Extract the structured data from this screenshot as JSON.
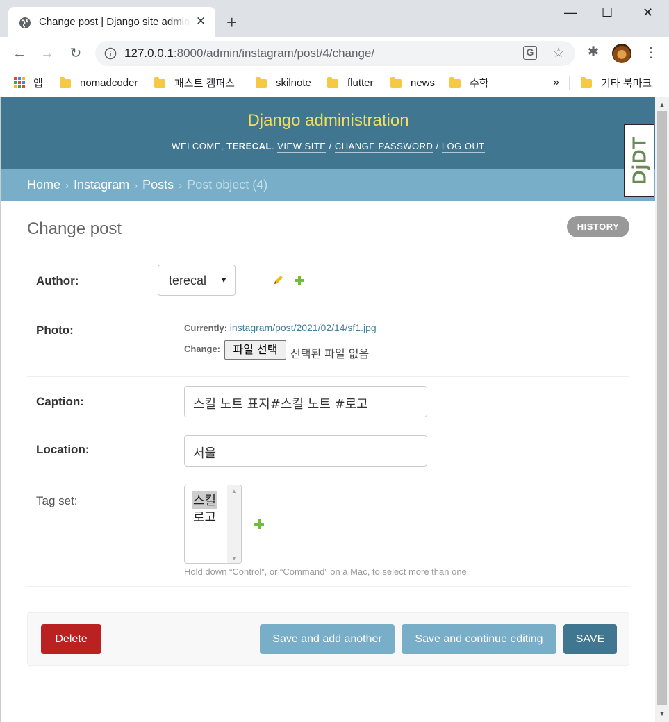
{
  "browser": {
    "tab_title": "Change post | Django site admin",
    "tab_close": "✕",
    "new_tab": "+",
    "url_host": "127.0.0.1",
    "url_rest": ":8000/admin/instagram/post/4/change/",
    "window_controls": {
      "minimize": "—",
      "maximize": "☐",
      "close": "✕"
    },
    "bookmarks": [
      {
        "label": "앱",
        "type": "apps"
      },
      {
        "label": "nomadcoder",
        "type": "folder"
      },
      {
        "label": "패스트 캠퍼스",
        "type": "folder"
      },
      {
        "label": "skilnote",
        "type": "folder"
      },
      {
        "label": "flutter",
        "type": "folder"
      },
      {
        "label": "news",
        "type": "folder"
      },
      {
        "label": "수학",
        "type": "folder"
      }
    ],
    "bookmarks_overflow": "»",
    "other_bookmarks": "기타 북마크"
  },
  "admin": {
    "site_name": "Django administration",
    "welcome": "WELCOME,",
    "username": "TERECAL",
    "view_site": "VIEW SITE",
    "change_password": "CHANGE PASSWORD",
    "log_out": "LOG OUT",
    "slash": "/",
    "djdt": "DjDT"
  },
  "breadcrumbs": {
    "home": "Home",
    "app": "Instagram",
    "model": "Posts",
    "current": "Post object (4)",
    "sep": "›"
  },
  "page": {
    "title": "Change post",
    "history": "HISTORY"
  },
  "form": {
    "author": {
      "label": "Author:",
      "value": "terecal"
    },
    "photo": {
      "label": "Photo:",
      "currently_label": "Currently:",
      "currently_value": "instagram/post/2021/02/14/sf1.jpg",
      "change_label": "Change:",
      "choose_button": "파일 선택",
      "no_file": "선택된 파일 없음"
    },
    "caption": {
      "label": "Caption:",
      "value": "스킬 노트 표지#스킬 노트 #로고"
    },
    "location": {
      "label": "Location:",
      "value": "서울"
    },
    "tag_set": {
      "label": "Tag set:",
      "options": [
        "스킬",
        "로고"
      ],
      "selected": [
        "스킬"
      ],
      "help": "Hold down “Control”, or “Command” on a Mac, to select more than one."
    }
  },
  "actions": {
    "delete": "Delete",
    "save_add_another": "Save and add another",
    "save_continue": "Save and continue editing",
    "save": "SAVE"
  },
  "colors": {
    "header_bg": "#417690",
    "branding": "#f5dd5d",
    "breadcrumbs_bg": "#79aec8",
    "delete": "#ba2121",
    "add_green": "#70bf2b"
  }
}
